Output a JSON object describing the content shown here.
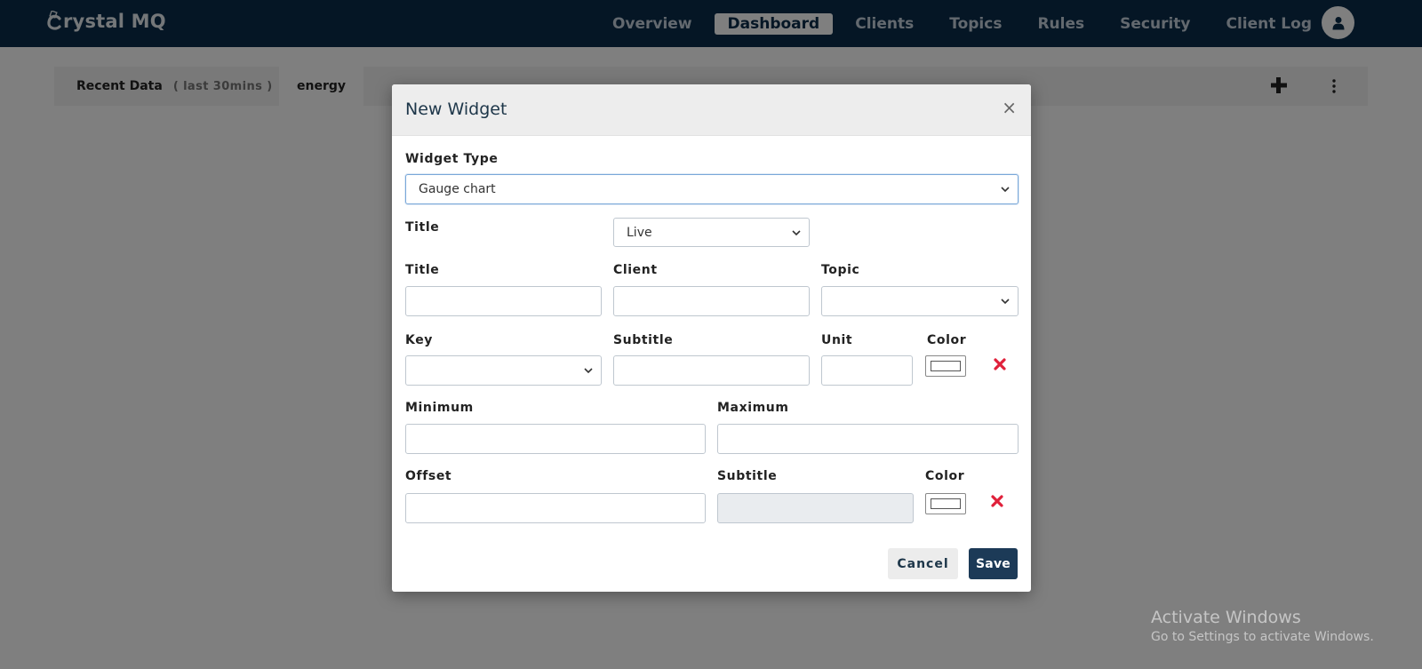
{
  "app": {
    "logo_text": "rystal MQ"
  },
  "nav": {
    "items": [
      {
        "label": "Overview"
      },
      {
        "label": "Dashboard",
        "active": true
      },
      {
        "label": "Clients"
      },
      {
        "label": "Topics"
      },
      {
        "label": "Rules"
      },
      {
        "label": "Security"
      },
      {
        "label": "Client Log"
      }
    ]
  },
  "tabs": {
    "recent_label": "Recent Data",
    "recent_sub": "( last 30mins )",
    "energy_label": "energy"
  },
  "modal": {
    "title": "New Widget",
    "close_symbol": "×",
    "widget_type_label": "Widget Type",
    "widget_type_value": "Gauge chart",
    "title_mode_label": "Title",
    "title_mode_value": "Live",
    "title_label": "Title",
    "client_label": "Client",
    "topic_label": "Topic",
    "key_label": "Key",
    "subtitle_label": "Subtitle",
    "unit_label": "Unit",
    "color_label": "Color",
    "minimum_label": "Minimum",
    "maximum_label": "Maximum",
    "offset_label": "Offset",
    "subtitle2_label": "Subtitle",
    "color2_label": "Color",
    "cancel_label": "Cancel",
    "save_label": "Save"
  },
  "colors": {
    "navbar_bg": "#0a2c4a",
    "save_bg": "#1c3a57",
    "remove_red": "#e0203a"
  },
  "watermark": {
    "line1": "Activate Windows",
    "line2": "Go to Settings to activate Windows."
  }
}
